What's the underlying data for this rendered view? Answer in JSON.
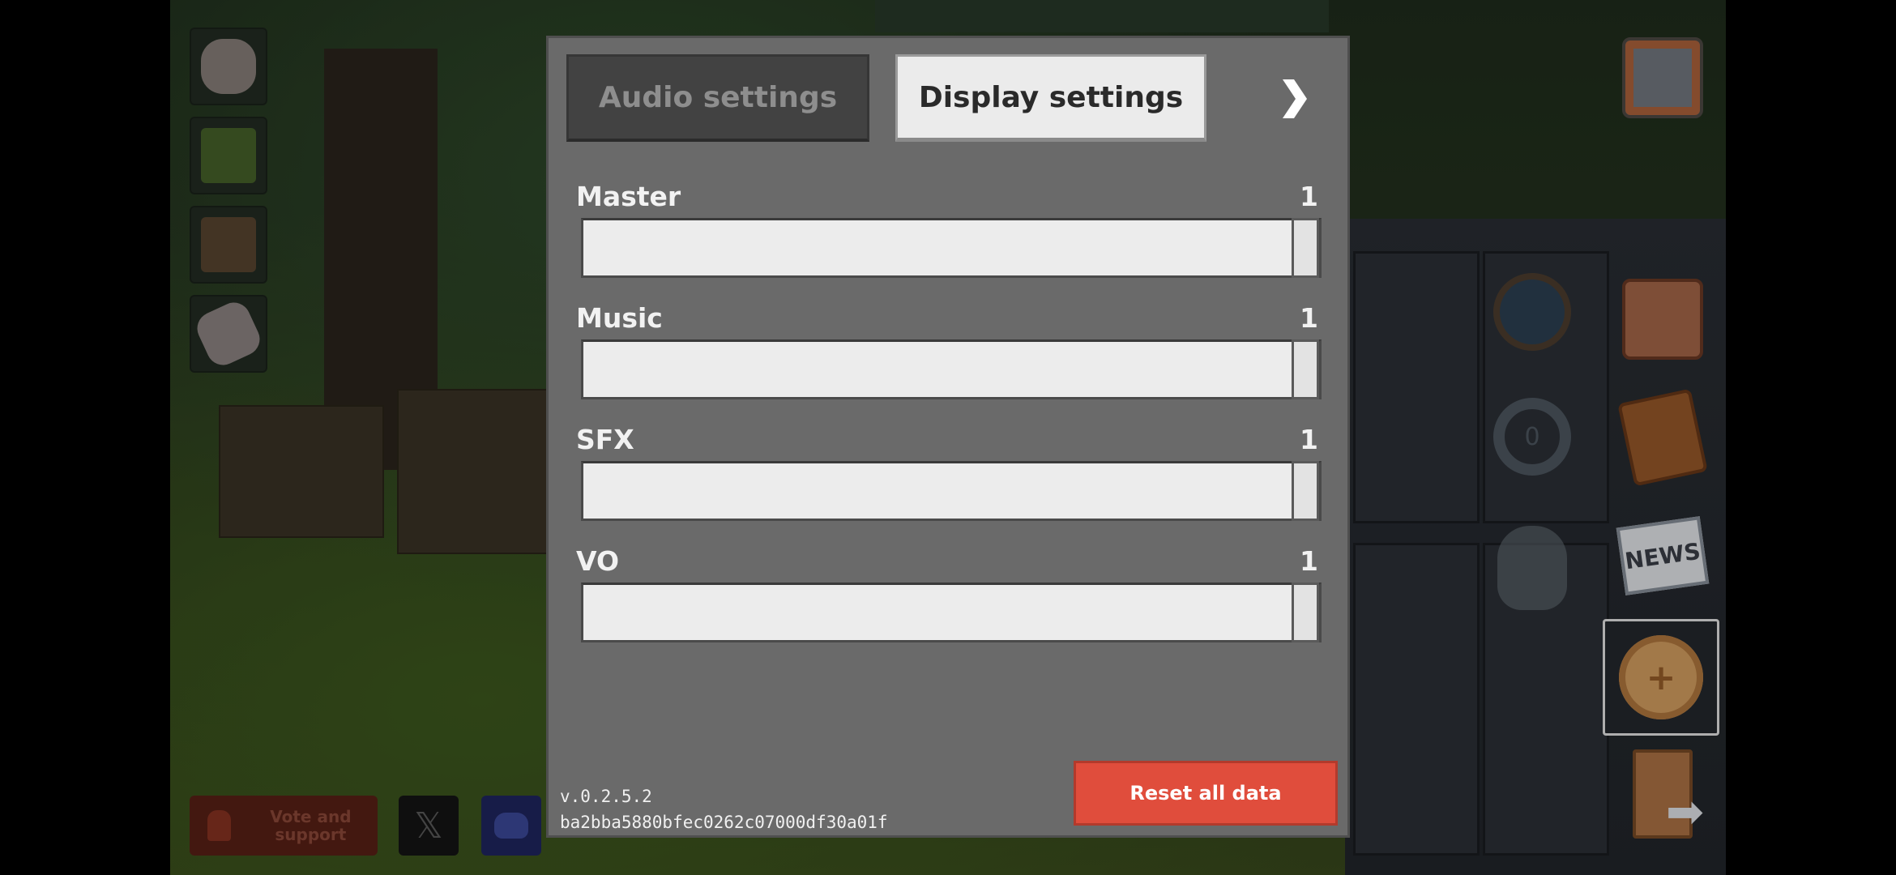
{
  "tabs": {
    "audio": "Audio settings",
    "display": "Display settings"
  },
  "settings": [
    {
      "label": "Master",
      "value": "1",
      "level": 1.0
    },
    {
      "label": "Music",
      "value": "1",
      "level": 1.0
    },
    {
      "label": "SFX",
      "value": "1",
      "level": 1.0
    },
    {
      "label": "VO",
      "value": "1",
      "level": 1.0
    }
  ],
  "footer": {
    "version": "v.0.2.5.2",
    "build_hash": "ba2bba5880bfec0262c07000df30a01f",
    "reset_label": "Reset all data"
  },
  "bottom_bar": {
    "vote_label": "Vote and support",
    "x_glyph": "𝕏"
  },
  "right_menu": {
    "news_text": "NEWS"
  },
  "colors": {
    "reset_button": "#e04d3c",
    "panel": "#6a6a6a",
    "active_tab": "#ebebeb",
    "inactive_tab": "#424242"
  }
}
